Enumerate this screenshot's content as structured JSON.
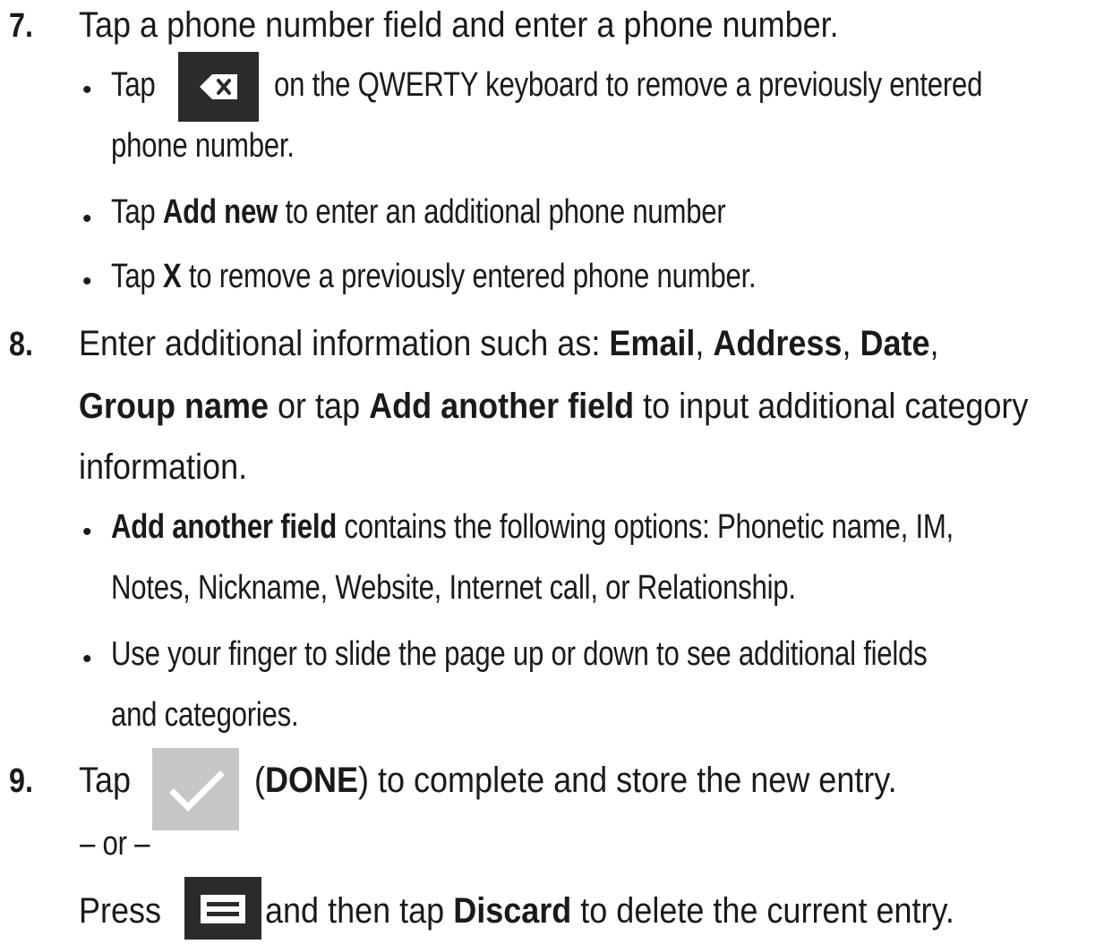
{
  "step7": {
    "number": "7.",
    "text": "Tap a phone number field and enter a phone number.",
    "bullet_char": "•",
    "b1": {
      "pre": "Tap",
      "post": "on the QWERTY keyboard to remove a previously entered",
      "line2": "phone number.",
      "icon": "backspace-key-icon"
    },
    "b2": {
      "pre": "Tap ",
      "bold": "Add new",
      "post": " to enter an additional phone number"
    },
    "b3": {
      "pre": "Tap ",
      "bold": "X",
      "post": " to remove a previously entered phone number."
    }
  },
  "step8": {
    "number": "8.",
    "line1": {
      "pre": "Enter additional information such as: ",
      "b1": "Email",
      "s1": ", ",
      "b2": "Address",
      "s2": ", ",
      "b3": "Date",
      "s3": ","
    },
    "line2": {
      "b1": "Group name",
      "s1": " or tap ",
      "b2": "Add another field",
      "s2": " to input additional category"
    },
    "line3": "information.",
    "bullet1": {
      "bold": "Add another field",
      "post": " contains the following options: Phonetic name, IM,",
      "line2": "Notes, Nickname, Website, Internet call, or Relationship."
    },
    "bullet2": {
      "line1": "Use your finger to slide the page up or down to see additional fields",
      "line2": "and categories."
    }
  },
  "step9": {
    "number": "9.",
    "pre": "Tap",
    "paren_open": "(",
    "bold": "DONE",
    "post": ") to complete and store the new entry.",
    "or": "– or –",
    "line3": {
      "pre": "Press",
      "mid": " and then tap ",
      "bold": "Discard",
      "post": " to delete the current entry."
    },
    "done_icon": "checkmark-icon",
    "menu_icon": "menu-key-icon"
  },
  "colors": {
    "text": "#1a1a1a",
    "icon_dark": "#2b2b2b",
    "icon_light": "#c4c6c8"
  }
}
